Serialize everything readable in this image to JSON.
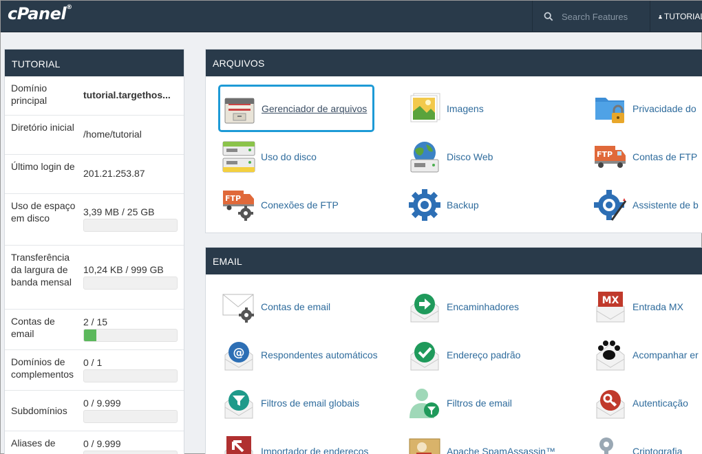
{
  "topbar": {
    "logo": "cPanel",
    "logo_mark": "®",
    "search_placeholder": "Search Features",
    "user": "TUTORIAL"
  },
  "sidebar": {
    "title": "TUTORIAL",
    "stats": [
      {
        "label": "Domínio principal",
        "value": "tutorial.targethos..."
      },
      {
        "label": "Diretório inicial",
        "value": "/home/tutorial"
      },
      {
        "label": "Último login de",
        "value": "201.21.253.87"
      },
      {
        "label": "Uso de espaço em disco",
        "value": "3,39 MB / 25 GB",
        "usage": 0.0
      },
      {
        "label": "Transferência da largura de banda mensal",
        "value": "10,24 KB / 999 GB",
        "usage": 0.0
      },
      {
        "label": "Contas de email",
        "value": "2 / 15",
        "usage": 0.133
      },
      {
        "label": "Domínios de complementos",
        "value": "0 / 1",
        "usage": 0.0
      },
      {
        "label": "Subdomínios",
        "value": "0 / 9.999",
        "usage": 0.0
      },
      {
        "label": "Aliases de",
        "value": "0 / 9.999"
      }
    ]
  },
  "files_section": {
    "title": "ARQUIVOS",
    "tools": [
      {
        "label": "Gerenciador de arquivos",
        "icon": "file-cabinet-icon"
      },
      {
        "label": "Imagens",
        "icon": "images-icon"
      },
      {
        "label": "Privacidade do",
        "icon": "folder-lock-icon"
      },
      {
        "label": "Uso do disco",
        "icon": "disk-usage-icon"
      },
      {
        "label": "Disco Web",
        "icon": "web-disk-icon"
      },
      {
        "label": "Contas de FTP",
        "icon": "ftp-truck-icon"
      },
      {
        "label": "Conexões de FTP",
        "icon": "ftp-gear-icon"
      },
      {
        "label": "Backup",
        "icon": "backup-gear-icon"
      },
      {
        "label": "Assistente de b",
        "icon": "backup-wizard-icon"
      }
    ]
  },
  "email_section": {
    "title": "EMAIL",
    "tools": [
      {
        "label": "Contas de email",
        "icon": "email-accounts-icon"
      },
      {
        "label": "Encaminhadores",
        "icon": "forwarders-icon"
      },
      {
        "label": "Entrada MX",
        "icon": "mx-entry-icon",
        "badge": "MX"
      },
      {
        "label": "Respondentes automáticos",
        "icon": "autoresponder-icon"
      },
      {
        "label": "Endereço padrão",
        "icon": "default-address-icon"
      },
      {
        "label": "Acompanhar er",
        "icon": "track-delivery-icon"
      },
      {
        "label": "Filtros de email globais",
        "icon": "global-filter-icon"
      },
      {
        "label": "Filtros de email",
        "icon": "email-filter-icon"
      },
      {
        "label": "Autenticação",
        "icon": "authentication-icon"
      },
      {
        "label": "Importador de endereços",
        "icon": "address-importer-icon"
      },
      {
        "label": "Apache SpamAssassin™",
        "icon": "spamassassin-icon"
      },
      {
        "label": "Criptografia",
        "icon": "encryption-icon"
      }
    ]
  },
  "colors": {
    "header_bg": "#293a4a",
    "link": "#2e6b9c",
    "selected_border": "#1d9ad6",
    "bar_fill": "#5cb85c"
  }
}
